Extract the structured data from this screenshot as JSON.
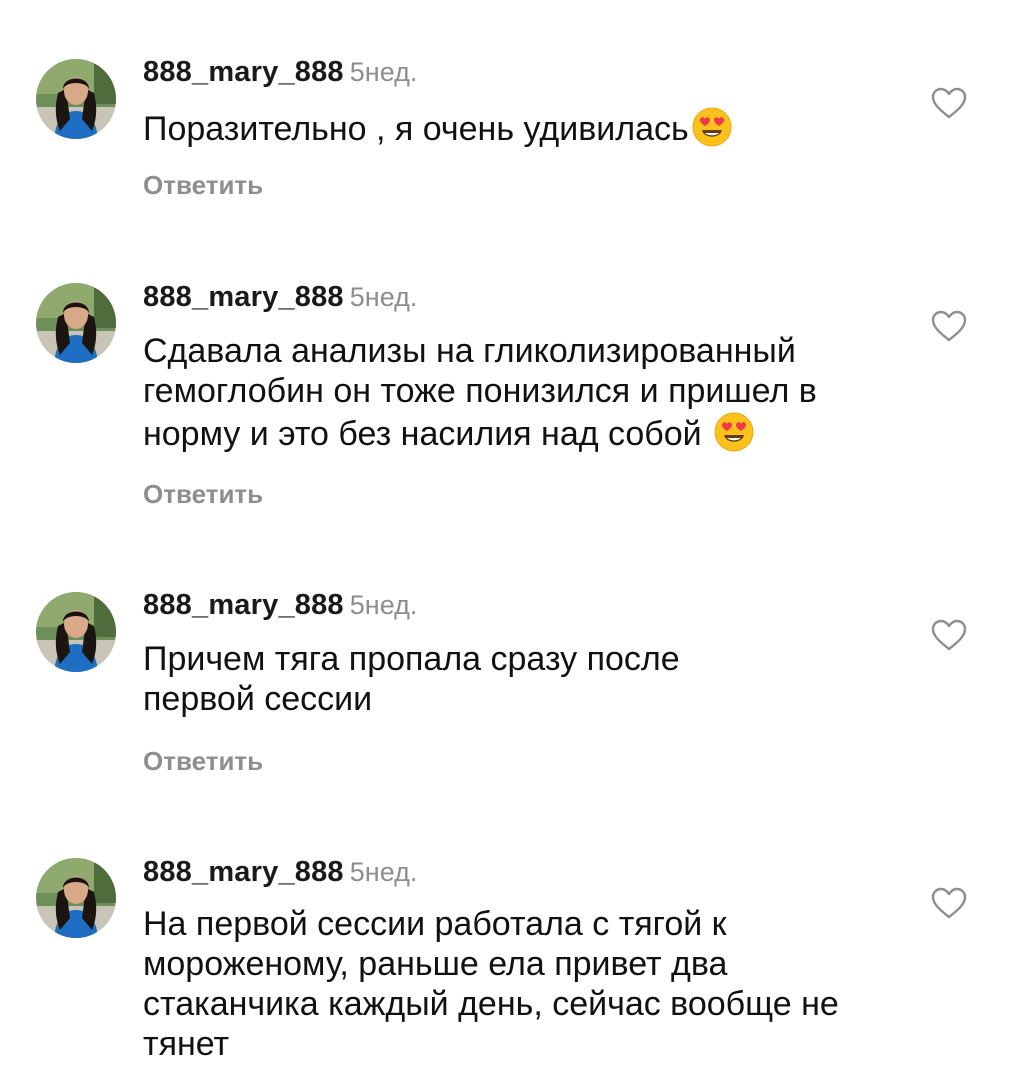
{
  "comments": [
    {
      "username": "888_mary_888",
      "time": "5нед.",
      "text": "Поразительно , я очень удивилась",
      "emoji": "smiling-face-with-heart-eyes",
      "reply_label": "Ответить"
    },
    {
      "username": "888_mary_888",
      "time": "5нед.",
      "text": "Сдавала анализы на гликолизированный гемоглобин он тоже понизился и пришел в норму и это без насилия над собой",
      "emoji": "smiling-face-with-heart-eyes",
      "reply_label": "Ответить"
    },
    {
      "username": "888_mary_888",
      "time": "5нед.",
      "text": "Причем тяга пропала сразу после первой сессии",
      "reply_label": "Ответить"
    },
    {
      "username": "888_mary_888",
      "time": "5нед.",
      "text": "На первой сессии работала с тягой к мороженому, раньше ела привет два стаканчика каждый день, сейчас вообще не тянет"
    }
  ],
  "icons": {
    "like": "heart-outline-icon",
    "avatar": "user-avatar"
  },
  "colors": {
    "text": "#111111",
    "muted": "#8e8e8e",
    "background": "#ffffff"
  }
}
